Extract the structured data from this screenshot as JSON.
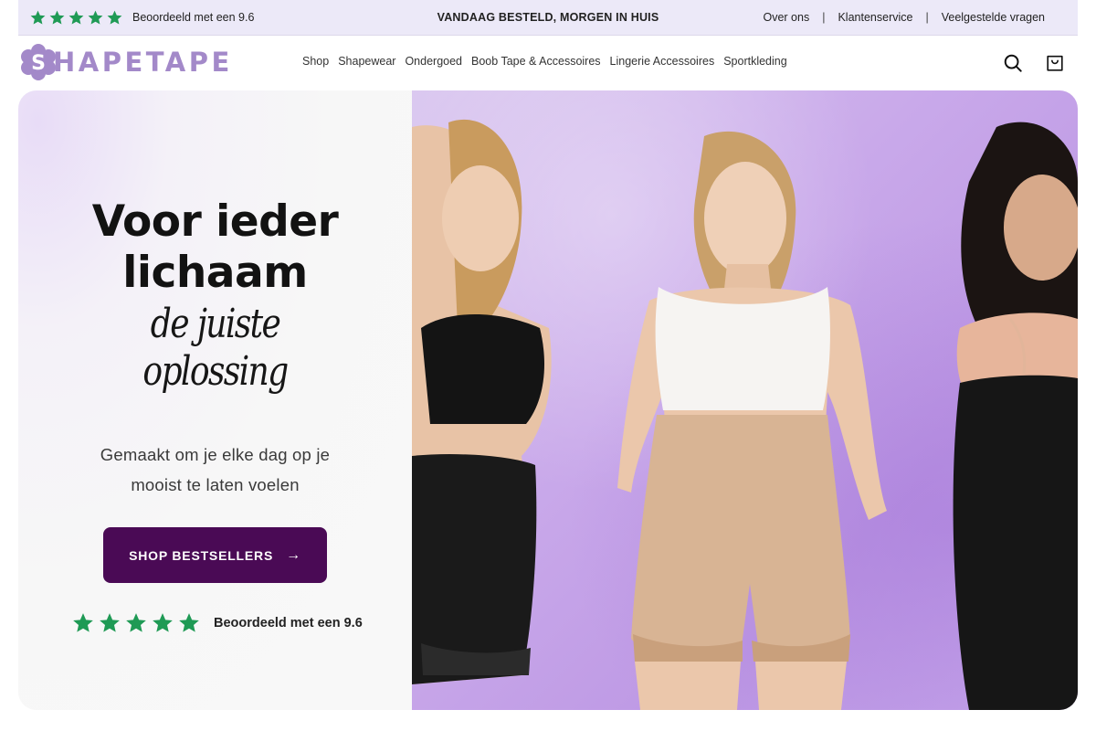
{
  "announcement": {
    "rating_text": "Beoordeeld met een 9.6",
    "center_text": "VANDAAG BESTELD, MORGEN IN HUIS",
    "links": [
      "Over ons",
      "Klantenservice",
      "Veelgestelde vragen"
    ],
    "separator": "|"
  },
  "header": {
    "logo_initial": "S",
    "logo_text": "HAPETAPE",
    "nav": [
      "Shop",
      "Shapewear",
      "Ondergoed",
      "Boob Tape & Accessoires",
      "Lingerie Accessoires",
      "Sportkleding"
    ],
    "icons": [
      "search-icon",
      "cart-icon"
    ]
  },
  "hero": {
    "headline_line1": "Voor ieder",
    "headline_line2": "lichaam",
    "script_line1": "de juiste",
    "script_line2": "oplossing",
    "sub_line1": "Gemaakt om je elke dag op je",
    "sub_line2": "mooist te laten voelen",
    "cta_label": "SHOP BESTSELLERS",
    "cta_arrow": "→",
    "rating_text": "Beoordeeld met een 9.6",
    "rating_stars": 5
  },
  "colors": {
    "announcement_bg": "#ece9f8",
    "logo_purple": "#a389c9",
    "cta_bg": "#4a0a55",
    "star_green": "#1f9a55",
    "hero_bg": "#c9a9ea"
  }
}
